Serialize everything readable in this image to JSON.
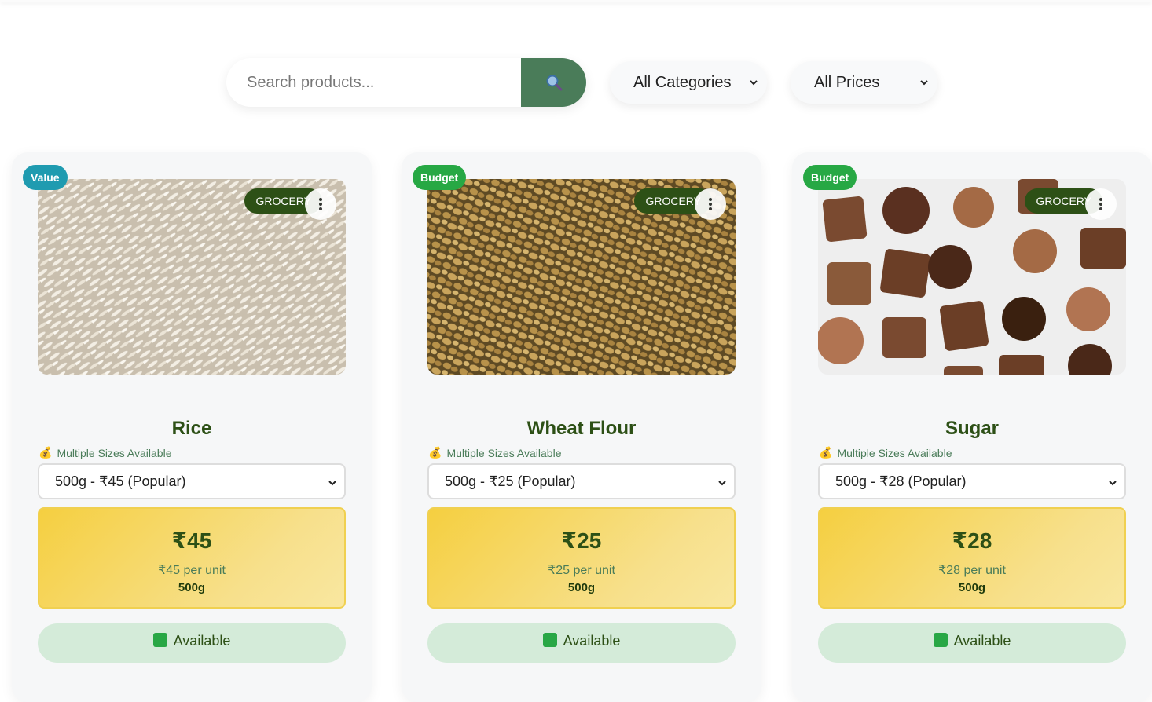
{
  "search": {
    "placeholder": "Search products...",
    "button_icon": "search-icon"
  },
  "filters": {
    "category": "All Categories",
    "price": "All Prices"
  },
  "products": [
    {
      "badge": "Value",
      "badge_color": "#1f9bb0",
      "category_tag": "GROCERY",
      "name": "Rice",
      "sizes_note": "Multiple Sizes Available",
      "selected_size": "500g - ₹45 (Popular)",
      "price": "₹45",
      "per_unit": "₹45 per unit",
      "size": "500g",
      "availability": "Available"
    },
    {
      "badge": "Budget",
      "badge_color": "#27a844",
      "category_tag": "GROCERY",
      "name": "Wheat Flour",
      "sizes_note": "Multiple Sizes Available",
      "selected_size": "500g - ₹25 (Popular)",
      "price": "₹25",
      "per_unit": "₹25 per unit",
      "size": "500g",
      "availability": "Available"
    },
    {
      "badge": "Budget",
      "badge_color": "#27a844",
      "category_tag": "GROCERY",
      "name": "Sugar",
      "sizes_note": "Multiple Sizes Available",
      "selected_size": "500g - ₹28 (Popular)",
      "price": "₹28",
      "per_unit": "₹28 per unit",
      "size": "500g",
      "availability": "Available"
    }
  ],
  "colors": {
    "accent": "#4a7c59",
    "heading": "#2d5016",
    "price_bg": "#f5cf40"
  }
}
